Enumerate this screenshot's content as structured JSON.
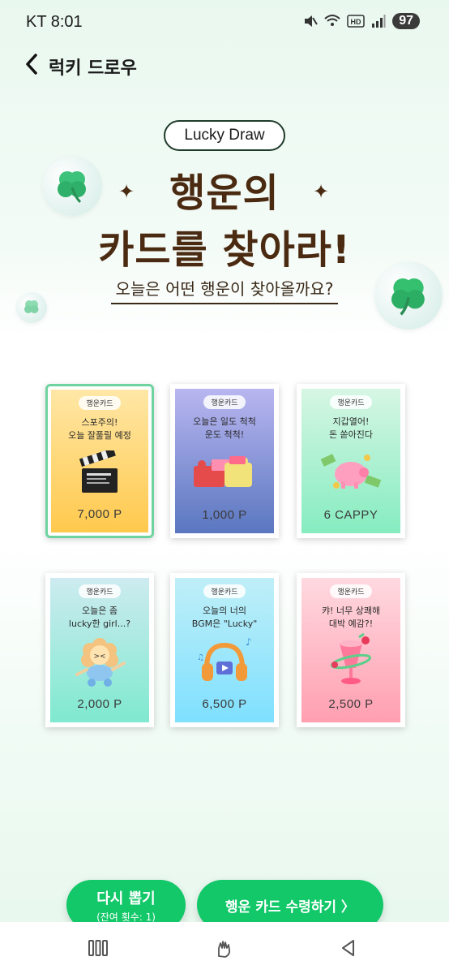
{
  "status_bar": {
    "time": "KT 8:01",
    "battery": "97",
    "icons": [
      "mute-icon",
      "wifi-icon",
      "hd-icon",
      "signal-icon"
    ]
  },
  "header": {
    "title": "럭키 드로우"
  },
  "hero": {
    "pill": "Lucky Draw",
    "title_line1": "행운의",
    "title_line2": "카드를 찾아라!",
    "subtitle": "오늘은 어떤 행운이 찾아올까요?"
  },
  "cards": [
    {
      "tag": "행운카드",
      "message": "스포주의!\n오늘 잘풀릴 예정",
      "value": "7,000 P",
      "icon": "clapperboard-icon",
      "gradient": [
        "#ffe7a6",
        "#ffc94d"
      ],
      "selected": true
    },
    {
      "tag": "행운카드",
      "message": "오늘은 일도 척척\n운도 척척!",
      "value": "1,000 P",
      "icon": "blocks-icon",
      "gradient": [
        "#b9b6f0",
        "#5a77c0"
      ],
      "selected": false
    },
    {
      "tag": "행운카드",
      "message": "지갑열어!\n돈 쏟아진다",
      "value": "6 CAPPY",
      "icon": "piggy-bank-icon",
      "gradient": [
        "#d6f6e4",
        "#86ecc0"
      ],
      "selected": false
    },
    {
      "tag": "행운카드",
      "message": "오늘은 좀\nlucky한 girl...?",
      "value": "2,000 P",
      "icon": "flower-character-icon",
      "gradient": [
        "#cdebf0",
        "#7fe9cf"
      ],
      "selected": false
    },
    {
      "tag": "행운카드",
      "message": "오늘의 너의\nBGM은 \"Lucky\"",
      "value": "6,500 P",
      "icon": "headphones-icon",
      "gradient": [
        "#bfeff7",
        "#7fe0ff"
      ],
      "selected": false
    },
    {
      "tag": "행운카드",
      "message": "캬! 너무 상쾌해\n대박 예감?!",
      "value": "2,500 P",
      "icon": "cocktail-icon",
      "gradient": [
        "#ffd9e0",
        "#ff9fb0"
      ],
      "selected": false
    }
  ],
  "buttons": {
    "redraw_label": "다시 뽑기",
    "redraw_sub": "(잔여 횟수: 1)",
    "receive_label": "행운 카드 수령하기 〉"
  },
  "colors": {
    "accent": "#12c869",
    "title": "#4b2a12"
  }
}
